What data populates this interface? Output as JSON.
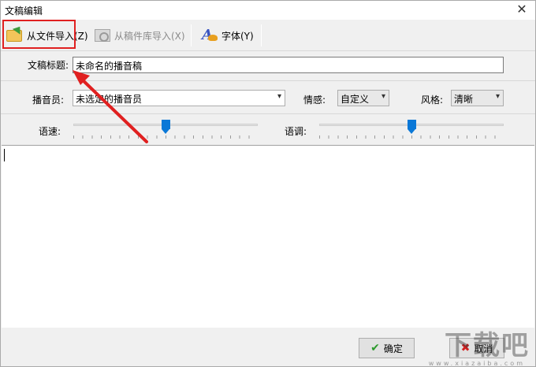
{
  "window": {
    "title": "文稿编辑",
    "close_glyph": "✕"
  },
  "toolbar": {
    "import_file_label": "从文件导入(Z)",
    "import_library_label": "从稿件库导入(X)",
    "font_label": "字体(Y)",
    "icons": [
      "folder-open-icon",
      "library-icon",
      "font-icon"
    ]
  },
  "form": {
    "title_label": "文稿标题:",
    "title_value": "未命名的播音稿",
    "announcer_label": "播音员:",
    "announcer_value": "未选定的播音员",
    "emotion_label": "情感:",
    "emotion_value": "自定义",
    "style_label": "风格:",
    "style_value": "清晰",
    "speed_label": "语速:",
    "pitch_label": "语调:",
    "speed_level": 0.5,
    "pitch_level": 0.5
  },
  "buttons": {
    "ok_label": "确定",
    "cancel_label": "取消"
  },
  "watermark": {
    "text": "下载吧",
    "sub": "www.xiazaiba.com"
  },
  "accent_colors": {
    "highlight": "#e02020",
    "slider": "#0a78d7"
  }
}
